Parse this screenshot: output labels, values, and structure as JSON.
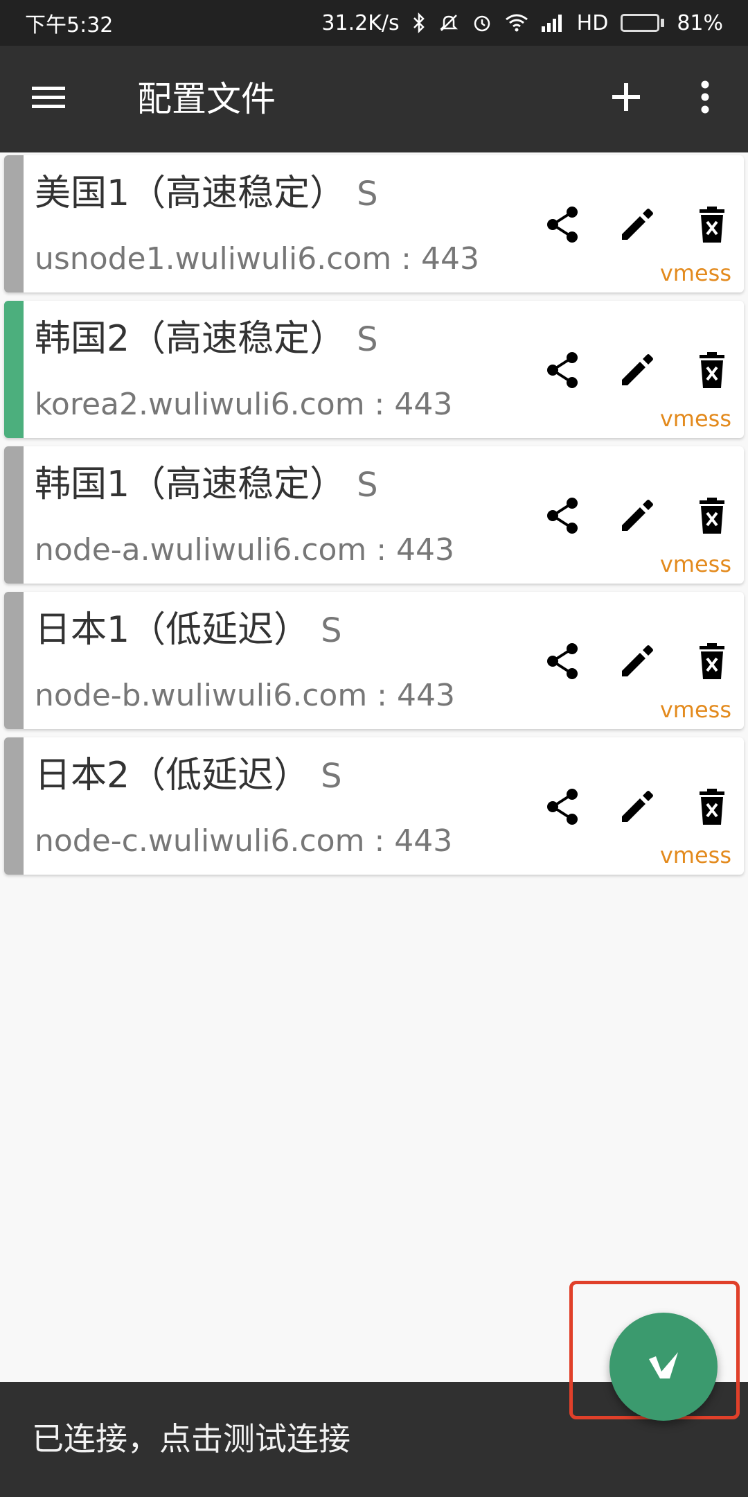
{
  "status_bar": {
    "time": "下午5:32",
    "speed": "31.2K/s",
    "network": "HD",
    "battery_percent": "81%",
    "battery_level": 0.81,
    "icons": [
      "bluetooth-icon",
      "mute-icon",
      "alarm-icon",
      "wifi-icon",
      "signal-icon",
      "battery-icon"
    ]
  },
  "app_bar": {
    "title": "配置文件",
    "icons": [
      "menu-icon",
      "add-icon",
      "more-vert-icon"
    ]
  },
  "colors": {
    "active_indicator": "#4caf7d",
    "inactive_indicator": "#a8a8a8",
    "protocol": "#e38a1d",
    "fab": "#3b9a6e",
    "highlight": "#e0402a"
  },
  "profiles": [
    {
      "name": "美国1（高速稳定）",
      "suffix": "S",
      "address": "usnode1.wuliwuli6.com : 443",
      "protocol": "vmess",
      "active": false
    },
    {
      "name": "韩国2（高速稳定）",
      "suffix": "S",
      "address": "korea2.wuliwuli6.com : 443",
      "protocol": "vmess",
      "active": true
    },
    {
      "name": "韩国1（高速稳定）",
      "suffix": "S",
      "address": "node-a.wuliwuli6.com : 443",
      "protocol": "vmess",
      "active": false
    },
    {
      "name": "日本1（低延迟）",
      "suffix": "S",
      "address": "node-b.wuliwuli6.com : 443",
      "protocol": "vmess",
      "active": false
    },
    {
      "name": "日本2（低延迟）",
      "suffix": "S",
      "address": "node-c.wuliwuli6.com : 443",
      "protocol": "vmess",
      "active": false
    }
  ],
  "row_actions": [
    "share-icon",
    "edit-icon",
    "delete-icon"
  ],
  "bottom_bar": {
    "status_text": "已连接，点击测试连接"
  },
  "fab": {
    "icon": "v-logo-icon"
  }
}
